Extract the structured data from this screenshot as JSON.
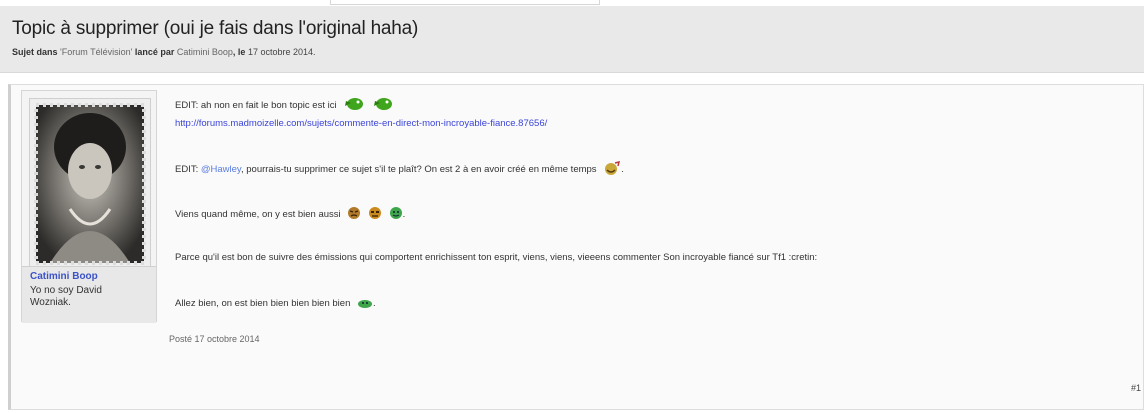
{
  "thread": {
    "title": "Topic à supprimer (oui je fais dans l'original haha)",
    "meta_prefix": "Sujet dans",
    "forum": "Forum Télévision",
    "started_by": "lancé par",
    "author": "Catimini Boop",
    "date_sep": ", le",
    "date": "17 octobre 2014."
  },
  "user": {
    "name": "Catimini Boop",
    "title": "Yo no soy David Wozniak."
  },
  "post": {
    "line1": "EDIT: ah non en fait le bon topic est ici",
    "link": "http://forums.madmoizelle.com/sujets/commente-en-direct-mon-incroyable-fiance.87656/",
    "line3_prefix": "EDIT: ",
    "mention": "@Hawley",
    "line3_rest": ", pourrais-tu supprimer ce sujet s'il te plaît? On est 2 à en avoir créé en même temps",
    "line4": "Viens quand même, on y est bien aussi",
    "line5": "Parce qu'il est bon de suivre des émissions qui comportent enrichissent ton esprit, viens, viens, vieeens commenter Son incroyable fiancé sur Tf1 :cretin:",
    "line6": "Allez bien, on est bien bien bien bien bien",
    "posted": "Posté 17 octobre 2014",
    "number": "#1"
  },
  "smileys": [
    "green-wink-smiley-icon",
    "green-smiley-icon",
    "laughing-smiley-icon",
    "angry-smiley-icon",
    "annoyed-smiley-icon",
    "green-smiley-icon",
    "green-smiley-icon"
  ],
  "colors": {
    "link": "#3b44d8",
    "mention": "#5a7de0",
    "username": "#3b52c8",
    "header_bg": "#e9e9e9"
  }
}
